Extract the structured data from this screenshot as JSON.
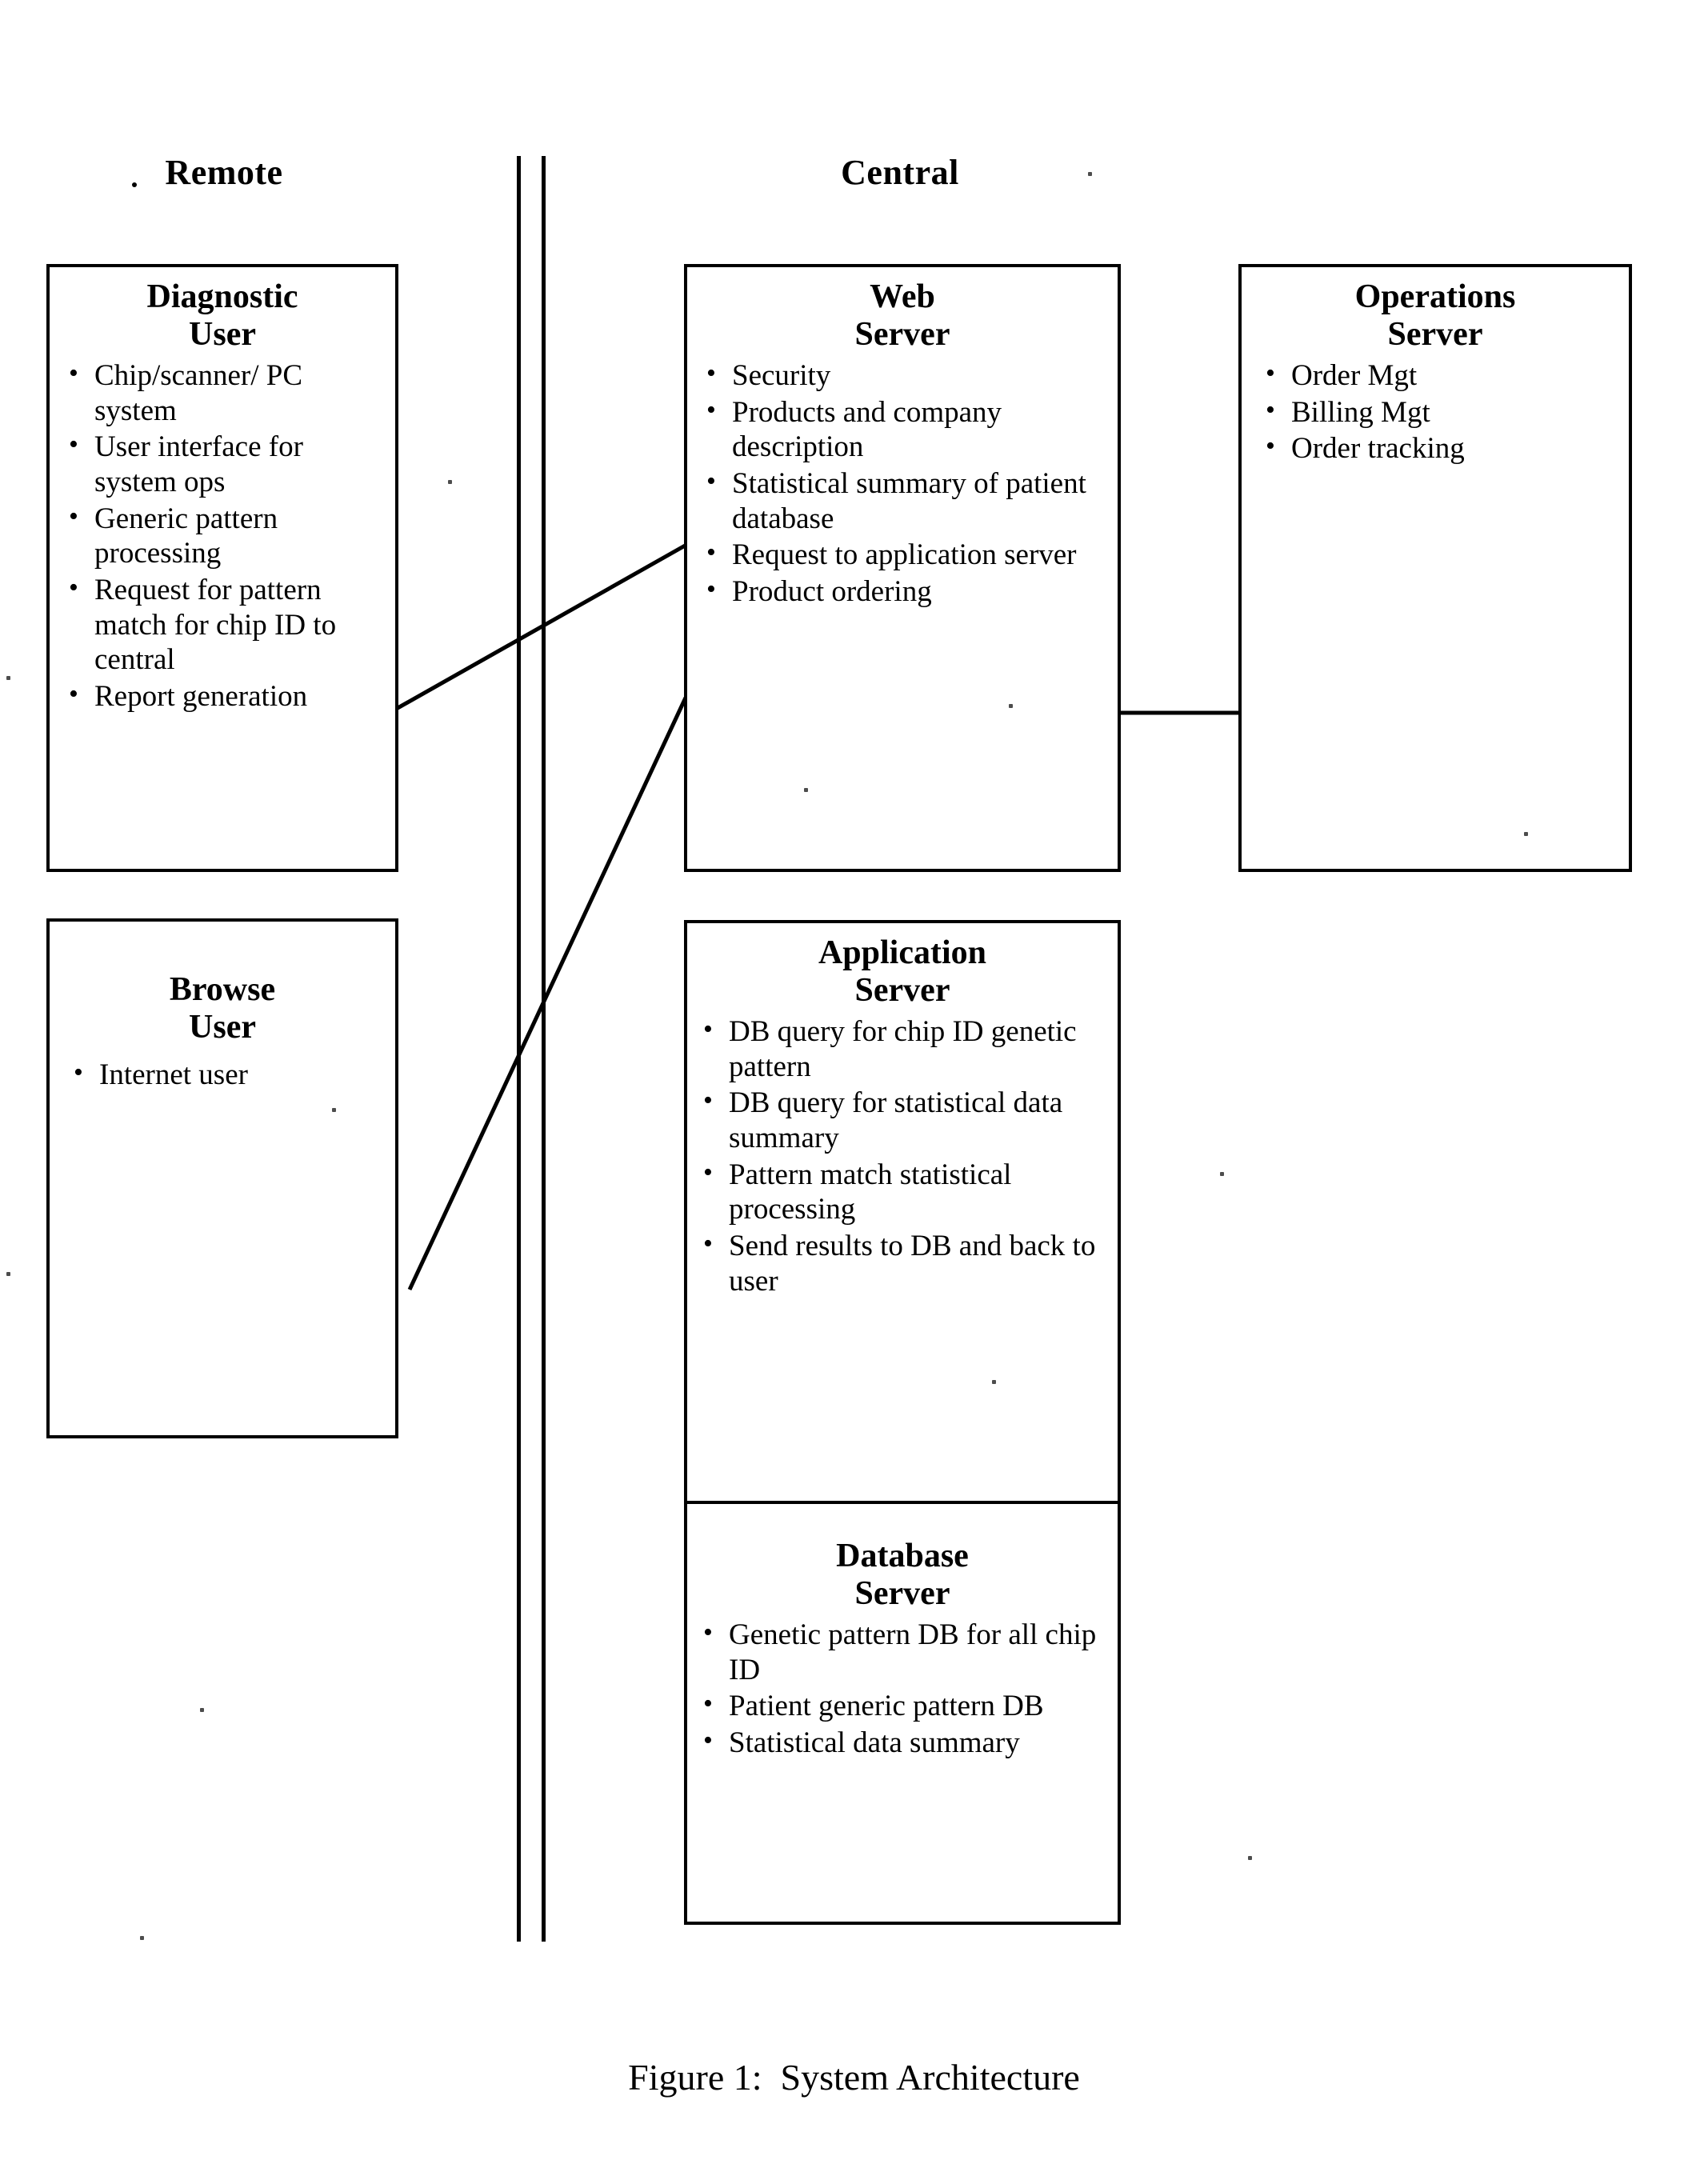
{
  "figure": {
    "caption": "Figure 1:  System Architecture"
  },
  "columns": {
    "remote_label": "Remote",
    "central_label": "Central"
  },
  "nodes": {
    "diagnostic_user": {
      "title": "Diagnostic\nUser",
      "items": [
        "Chip/scanner/ PC system",
        "User interface for system ops",
        "Generic pattern processing",
        "Request for pattern match for chip ID to central",
        "Report generation"
      ]
    },
    "browse_user": {
      "title": "Browse\nUser",
      "items": [
        "Internet user"
      ]
    },
    "web_server": {
      "title": "Web\nServer",
      "items": [
        "Security",
        "Products and company description",
        "Statistical summary of patient database",
        "Request to application server",
        "Product ordering"
      ]
    },
    "operations_server": {
      "title": "Operations\nServer",
      "items": [
        "Order Mgt",
        "Billing Mgt",
        "Order tracking"
      ]
    },
    "application_server": {
      "title": "Application\nServer",
      "items": [
        "DB query for chip ID genetic pattern",
        "DB query for statistical data summary",
        "Pattern match statistical processing",
        "Send results to DB and back to user"
      ]
    },
    "database_server": {
      "title": "Database\nServer",
      "items": [
        "Genetic pattern DB for all chip ID",
        "Patient generic pattern DB",
        "Statistical data summary"
      ]
    }
  },
  "colors": {
    "ink": "#000000",
    "paper": "#ffffff"
  }
}
